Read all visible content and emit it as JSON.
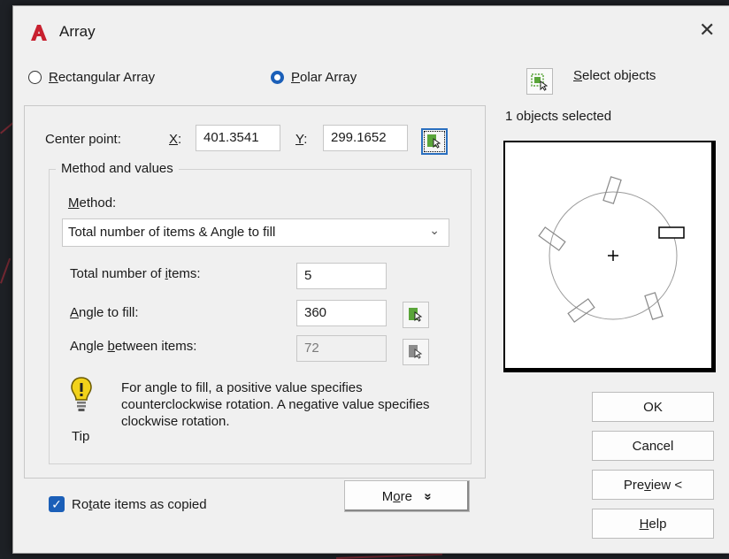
{
  "dialog": {
    "title": "Array",
    "close_glyph": "✕"
  },
  "mode": {
    "rect_label_key": "R",
    "rect_label_rest": "ectangular Array",
    "polar_label_key": "P",
    "polar_label_rest": "olar Array",
    "selected": "polar"
  },
  "select": {
    "label_key": "S",
    "label_rest": "elect objects",
    "count_text": "1 objects selected"
  },
  "center": {
    "label": "Center point:",
    "x_key": "X",
    "x_colon": ":",
    "x_value": "401.3541",
    "y_key": "Y",
    "y_colon": ":",
    "y_value": "299.1652"
  },
  "method_group": {
    "title": "Method and values",
    "method_key": "M",
    "method_rest": "ethod:",
    "method_value": "Total number of items & Angle to fill",
    "total_pre": "Total number of ",
    "total_key": "i",
    "total_post": "tems:",
    "total_value": "5",
    "angle_key": "A",
    "angle_rest": "ngle to fill:",
    "angle_value": "360",
    "between_pre": "Angle ",
    "between_key": "b",
    "between_post": "etween items:",
    "between_value": "72"
  },
  "tip": {
    "label": "Tip",
    "text": "For angle to fill, a positive value specifies counterclockwise rotation.  A negative value specifies clockwise rotation."
  },
  "rotate": {
    "checked": true,
    "pre": "Ro",
    "key": "t",
    "post": "ate items as copied"
  },
  "buttons": {
    "more_pre": "M",
    "more_key": "o",
    "more_post": "re",
    "more_glyph": "»",
    "ok": "OK",
    "cancel": "Cancel",
    "preview_pre": "Pre",
    "preview_key": "v",
    "preview_post": "iew <",
    "help_key": "H",
    "help_rest": "elp"
  },
  "colors": {
    "accent": "#1b5fb8",
    "app_icon": "#c8202f",
    "pick_green": "#5aa53a"
  },
  "icons": [
    "autocad-logo-icon",
    "close-icon",
    "select-objects-icon",
    "pick-point-icon",
    "pick-angle-icon",
    "lightbulb-tip-icon",
    "chevron-down-icon",
    "double-chevron-icon"
  ]
}
